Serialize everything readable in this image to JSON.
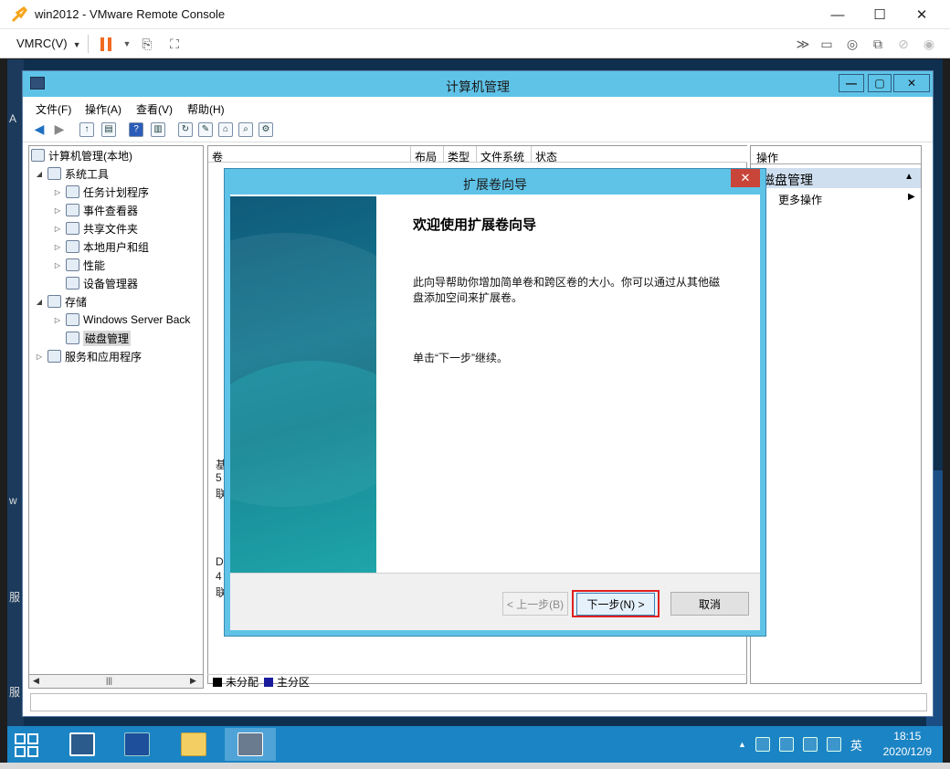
{
  "vmrc": {
    "title": "win2012 - VMware Remote Console",
    "menu_label": "VMRC(V)",
    "window_buttons": [
      "—",
      "☐",
      "✕"
    ]
  },
  "desktop": {
    "left_labels": [
      "A",
      "w",
      "服",
      "服"
    ]
  },
  "cm": {
    "title": "计算机管理",
    "menu": [
      "文件(F)",
      "操作(A)",
      "查看(V)",
      "帮助(H)"
    ],
    "tree": [
      {
        "label": "计算机管理(本地)",
        "level": 0,
        "expand": ""
      },
      {
        "label": "系统工具",
        "level": 1,
        "expand": "◢"
      },
      {
        "label": "任务计划程序",
        "level": 2,
        "expand": "▷"
      },
      {
        "label": "事件查看器",
        "level": 2,
        "expand": "▷"
      },
      {
        "label": "共享文件夹",
        "level": 2,
        "expand": "▷"
      },
      {
        "label": "本地用户和组",
        "level": 2,
        "expand": "▷"
      },
      {
        "label": "性能",
        "level": 2,
        "expand": "▷"
      },
      {
        "label": "设备管理器",
        "level": 2,
        "expand": ""
      },
      {
        "label": "存储",
        "level": 1,
        "expand": "◢"
      },
      {
        "label": "Windows Server Back",
        "level": 2,
        "expand": "▷"
      },
      {
        "label": "磁盘管理",
        "level": 2,
        "expand": ""
      },
      {
        "label": "服务和应用程序",
        "level": 1,
        "expand": "▷"
      }
    ],
    "columns": [
      "卷",
      "布局",
      "类型",
      "文件系统",
      "状态"
    ],
    "disk_labels": [
      "基",
      "5",
      "联",
      "D",
      "4",
      "联"
    ],
    "legend": {
      "unallocated": "未分配",
      "primary": "主分区"
    },
    "actions_header": "操作",
    "actions_group": "磁盘管理",
    "actions_more": "更多操作"
  },
  "wizard": {
    "title": "扩展卷向导",
    "heading": "欢迎使用扩展卷向导",
    "description": "此向导帮助你增加简单卷和跨区卷的大小。你可以通过从其他磁盘添加空间来扩展卷。",
    "hint": "单击“下一步”继续。",
    "back_label": "< 上一步(B)",
    "next_label": "下一步(N) >",
    "cancel_label": "取消",
    "close_glyph": "✕"
  },
  "taskbar": {
    "ime": "英",
    "time": "18:15",
    "date": "2020/12/9"
  },
  "colors": {
    "titlebar": "#5fc3e8",
    "taskbar": "#1b84c4",
    "highlight_border": "#e02020"
  }
}
